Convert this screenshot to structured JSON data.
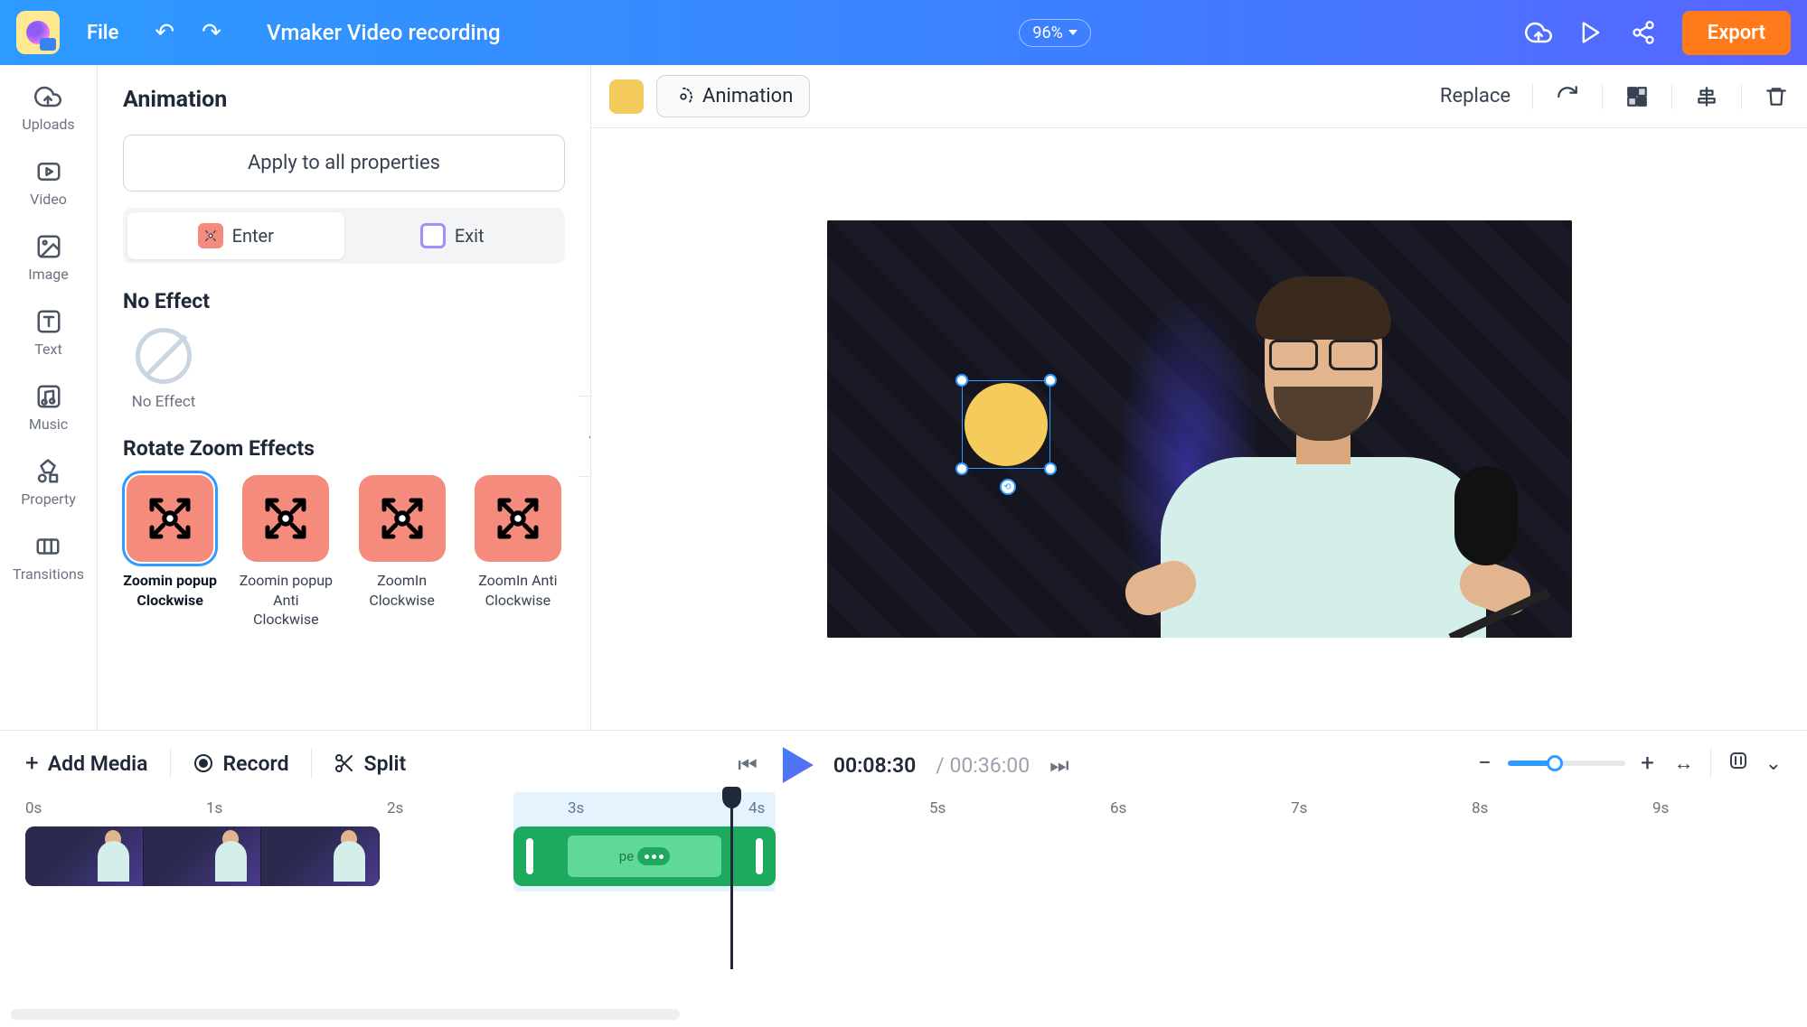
{
  "topbar": {
    "file": "File",
    "title": "Vmaker Video recording",
    "zoom": "96%",
    "export": "Export"
  },
  "sidebar": {
    "items": [
      {
        "label": "Uploads"
      },
      {
        "label": "Video"
      },
      {
        "label": "Image"
      },
      {
        "label": "Text"
      },
      {
        "label": "Music"
      },
      {
        "label": "Property"
      },
      {
        "label": "Transitions"
      }
    ]
  },
  "panel": {
    "title": "Animation",
    "apply_all": "Apply to all properties",
    "enter": "Enter",
    "exit": "Exit",
    "no_effect_section": "No Effect",
    "no_effect_label": "No Effect",
    "rotate_section": "Rotate Zoom Effects",
    "effects": [
      {
        "label": "Zoomin popup Clockwise"
      },
      {
        "label": "Zoomin popup Anti Clockwise"
      },
      {
        "label": "ZoomIn Clockwise"
      },
      {
        "label": "ZoomIn Anti Clockwise"
      }
    ]
  },
  "context": {
    "animation": "Animation",
    "replace": "Replace"
  },
  "timeline": {
    "add_media": "Add Media",
    "record": "Record",
    "split": "Split",
    "current": "00:08:30",
    "separator": "/",
    "total": "00:36:00",
    "ticks": [
      "0s",
      "1s",
      "2s",
      "3s",
      "4s",
      "5s",
      "6s",
      "7s",
      "8s",
      "9s"
    ],
    "shape_label": "pe"
  }
}
